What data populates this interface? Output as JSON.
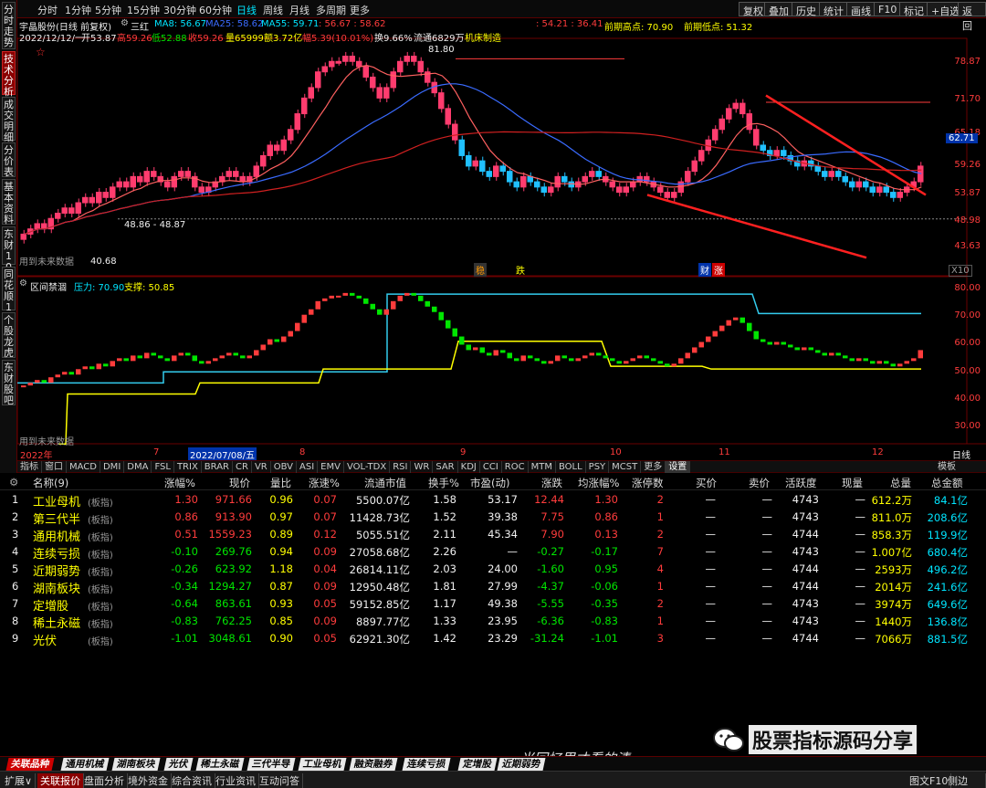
{
  "left_tabs": [
    "分时走势",
    "技术分析",
    "成交明细",
    "分价表",
    "基本资料",
    "东财10",
    "同花顺10",
    "个股龙虎",
    "东财股吧"
  ],
  "top_menu": {
    "periods": [
      "分时",
      "1分钟",
      "5分钟",
      "15分钟",
      "30分钟",
      "60分钟",
      "日线",
      "周线",
      "月线",
      "多周期",
      "更多"
    ],
    "active_period": "日线",
    "right_buttons": [
      "复权",
      "叠加",
      "历史",
      "统计",
      "画线",
      "F10",
      "标记",
      "+自选",
      "返回"
    ]
  },
  "chart_header": {
    "stock": "宇晶股份(日线 前复权)",
    "indicator_name": "三红",
    "ma8": "MA8: 56.67",
    "ma25": "MA25: 58.62",
    "ma55": "MA55: 59.71",
    "extra1": ": 56.67 : 58.62",
    "extra2": ": 54.21 : 36.41",
    "prev_high": "前期高点: 70.90",
    "prev_low": "前期低点: 51.32",
    "line2_date": "2022/12/12/一",
    "open": "开53.87",
    "high": "高59.26",
    "low": "低52.88",
    "close": "收59.26",
    "volume": "量65999",
    "amount": "额3.72亿",
    "change": "幅5.39(10.01%)",
    "turnover": "换9.66%",
    "float": "流通6829万",
    "industry": "机床制造",
    "star": "☆"
  },
  "price_axis": [
    "78.87",
    "71.70",
    "65.18",
    "59.26",
    "53.87",
    "48.98",
    "43.63"
  ],
  "current_price_tag": "62.71",
  "annotations": {
    "peak": "81.80",
    "range": "48.86 - 48.87",
    "low": "40.68",
    "future1": "用到未来数据",
    "future2": "用到未来数据",
    "mark1": "稳",
    "mark2": "跌",
    "mark3": "财",
    "mark4": "涨",
    "x10": "X10"
  },
  "sub_header": {
    "name": "区间禁涸",
    "pressure": "压力: 70.90",
    "support": "支撑: 50.85"
  },
  "sub_axis": [
    "80.00",
    "70.00",
    "60.00",
    "50.00",
    "40.00",
    "30.00"
  ],
  "date_axis": {
    "year": "2022年",
    "m7": "7",
    "cursor": "2022/07/08/五",
    "m8": "8",
    "m9": "9",
    "m10": "10",
    "m11": "11",
    "m12": "12",
    "period": "日线"
  },
  "indicator_tabs": [
    "指标",
    "窗口",
    "MACD",
    "DMI",
    "DMA",
    "FSL",
    "TRIX",
    "BRAR",
    "CR",
    "VR",
    "OBV",
    "ASI",
    "EMV",
    "VOL-TDX",
    "RSI",
    "WR",
    "SAR",
    "KDJ",
    "CCI",
    "ROC",
    "MTM",
    "BOLL",
    "PSY",
    "MCST",
    "更多",
    "设置"
  ],
  "indicator_right": "模板",
  "table": {
    "columns": [
      "名称(9)",
      "涨幅%",
      "现价",
      "量比",
      "涨速%",
      "流通市值",
      "换手%",
      "市盈(动)",
      "涨跌",
      "均涨幅%",
      "涨停数",
      "买价",
      "卖价",
      "活跃度",
      "现量",
      "总量",
      "总金额"
    ],
    "rows": [
      {
        "no": "1",
        "name": "工业母机",
        "tag": "(板指)",
        "chg": "1.30",
        "price": "971.66",
        "vr": "0.96",
        "spd": "0.07",
        "cap": "5500.07亿",
        "turn": "1.58",
        "pe": "53.17",
        "diff": "12.44",
        "avg": "1.30",
        "lim": "2",
        "buy": "—",
        "sell": "—",
        "act": "4743",
        "cur": "—",
        "vol": "612.2万",
        "amt": "84.1亿",
        "up": true
      },
      {
        "no": "2",
        "name": "第三代半",
        "tag": "(板指)",
        "chg": "0.86",
        "price": "913.90",
        "vr": "0.97",
        "spd": "0.07",
        "cap": "11428.73亿",
        "turn": "1.52",
        "pe": "39.38",
        "diff": "7.75",
        "avg": "0.86",
        "lim": "1",
        "buy": "—",
        "sell": "—",
        "act": "4743",
        "cur": "—",
        "vol": "811.0万",
        "amt": "208.6亿",
        "up": true
      },
      {
        "no": "3",
        "name": "通用机械",
        "tag": "(板指)",
        "chg": "0.51",
        "price": "1559.23",
        "vr": "0.89",
        "spd": "0.12",
        "cap": "5055.51亿",
        "turn": "2.11",
        "pe": "45.34",
        "diff": "7.90",
        "avg": "0.13",
        "lim": "2",
        "buy": "—",
        "sell": "—",
        "act": "4744",
        "cur": "—",
        "vol": "858.3万",
        "amt": "119.9亿",
        "up": true
      },
      {
        "no": "4",
        "name": "连续亏损",
        "tag": "(板指)",
        "chg": "-0.10",
        "price": "269.76",
        "vr": "0.94",
        "spd": "0.09",
        "cap": "27058.68亿",
        "turn": "2.26",
        "pe": "—",
        "diff": "-0.27",
        "avg": "-0.17",
        "lim": "7",
        "buy": "—",
        "sell": "—",
        "act": "4743",
        "cur": "—",
        "vol": "1.007亿",
        "amt": "680.4亿",
        "up": false
      },
      {
        "no": "5",
        "name": "近期弱势",
        "tag": "(板指)",
        "chg": "-0.26",
        "price": "623.92",
        "vr": "1.18",
        "spd": "0.04",
        "cap": "26814.11亿",
        "turn": "2.03",
        "pe": "24.00",
        "diff": "-1.60",
        "avg": "0.95",
        "lim": "4",
        "buy": "—",
        "sell": "—",
        "act": "4744",
        "cur": "—",
        "vol": "2593万",
        "amt": "496.2亿",
        "up": false
      },
      {
        "no": "6",
        "name": "湖南板块",
        "tag": "(板指)",
        "chg": "-0.34",
        "price": "1294.27",
        "vr": "0.87",
        "spd": "0.09",
        "cap": "12950.48亿",
        "turn": "1.81",
        "pe": "27.99",
        "diff": "-4.37",
        "avg": "-0.06",
        "lim": "1",
        "buy": "—",
        "sell": "—",
        "act": "4744",
        "cur": "—",
        "vol": "2014万",
        "amt": "241.6亿",
        "up": false
      },
      {
        "no": "7",
        "name": "定增股",
        "tag": "(板指)",
        "chg": "-0.64",
        "price": "863.61",
        "vr": "0.93",
        "spd": "0.05",
        "cap": "59152.85亿",
        "turn": "1.17",
        "pe": "49.38",
        "diff": "-5.55",
        "avg": "-0.35",
        "lim": "2",
        "buy": "—",
        "sell": "—",
        "act": "4743",
        "cur": "—",
        "vol": "3974万",
        "amt": "649.6亿",
        "up": false
      },
      {
        "no": "8",
        "name": "稀土永磁",
        "tag": "(板指)",
        "chg": "-0.83",
        "price": "762.25",
        "vr": "0.85",
        "spd": "0.09",
        "cap": "8897.77亿",
        "turn": "1.33",
        "pe": "23.95",
        "diff": "-6.36",
        "avg": "-0.83",
        "lim": "1",
        "buy": "—",
        "sell": "—",
        "act": "4743",
        "cur": "—",
        "vol": "1440万",
        "amt": "136.8亿",
        "up": false
      },
      {
        "no": "9",
        "name": "光伏",
        "tag": "(板指)",
        "chg": "-1.01",
        "price": "3048.61",
        "vr": "0.90",
        "spd": "0.05",
        "cap": "62921.30亿",
        "turn": "1.42",
        "pe": "23.29",
        "diff": "-31.24",
        "avg": "-1.01",
        "lim": "3",
        "buy": "—",
        "sell": "—",
        "act": "4744",
        "cur": "—",
        "vol": "7066万",
        "amt": "881.5亿",
        "up": false
      }
    ]
  },
  "bottom_tabs": [
    "关联品种",
    "通用机械",
    "湖南板块",
    "光伏",
    "稀土永磁",
    "三代半导",
    "工业母机",
    "融资融券",
    "连续亏损",
    "定增股",
    "近期弱势"
  ],
  "status_bar": [
    "扩展∨",
    "关联报价",
    "盘面分析",
    "境外资金",
    "综合资讯",
    "行业资讯",
    "互动问答"
  ],
  "status_right": [
    "图文F10",
    "侧边栏»"
  ],
  "watermark": "股票指标源码分享",
  "handwriting": "当回忆里才看的清",
  "colors": {
    "up": "#ff3c3c",
    "down": "#00e600",
    "bg": "#000000",
    "cyan": "#00e5ff",
    "yellow": "#ffff00"
  }
}
